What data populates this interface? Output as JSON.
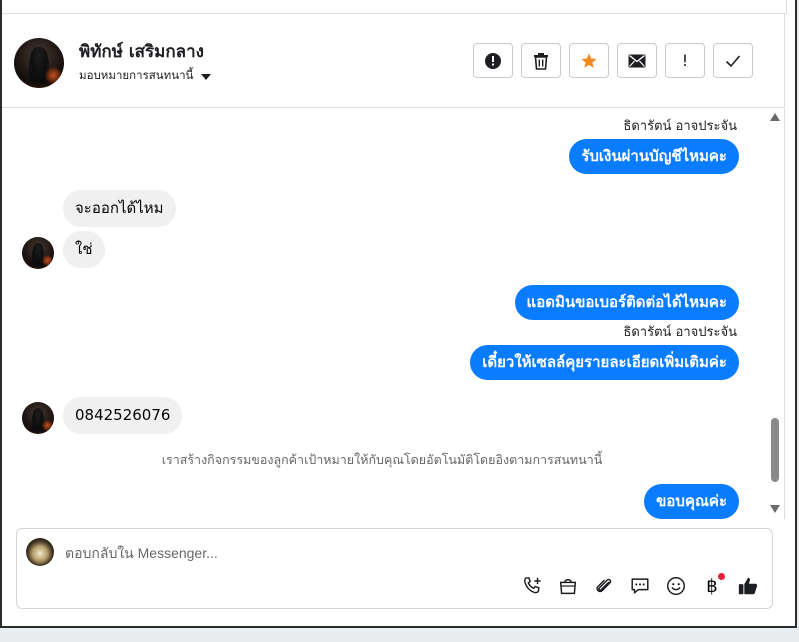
{
  "header": {
    "name": "พิทักษ์ เสริมกลาง",
    "assign_label": "มอบหมายการสนทนานี้"
  },
  "actions": [
    {
      "name": "spam-button",
      "icon": "alert-circle-icon"
    },
    {
      "name": "delete-button",
      "icon": "trash-icon"
    },
    {
      "name": "star-button",
      "icon": "star-icon"
    },
    {
      "name": "mark-unread-button",
      "icon": "envelope-icon"
    },
    {
      "name": "follow-up-button",
      "icon": "exclamation-icon",
      "label": "!"
    },
    {
      "name": "mark-done-button",
      "icon": "check-icon"
    }
  ],
  "thread": {
    "messages": [
      {
        "dir": "label",
        "text": "ธิดารัตน์ อาจประจัน"
      },
      {
        "dir": "out",
        "text": "รับเงินผ่านบัญชีไหมคะ"
      },
      {
        "dir": "in",
        "text": "จะออกได้ไหม"
      },
      {
        "dir": "in",
        "text": "ใช่"
      },
      {
        "dir": "out",
        "text": "แอดมินขอเบอร์ติดต่อได้ไหมคะ"
      },
      {
        "dir": "label",
        "text": "ธิดารัตน์ อาจประจัน"
      },
      {
        "dir": "out",
        "text": "เดี๋ยวให้เซลล์คุยรายละเอียดเพิ่มเติมค่ะ"
      },
      {
        "dir": "in",
        "text": "0842526076"
      },
      {
        "dir": "system",
        "text": "เราสร้างกิจกรรมของลูกค้าเป้าหมายให้กับคุณโดยอัตโนมัติโดยอิงตามการสนทนานี้"
      },
      {
        "dir": "out",
        "text": "ขอบคุณค่ะ"
      }
    ]
  },
  "composer": {
    "placeholder": "ตอบกลับใน Messenger..."
  },
  "tools": [
    {
      "name": "call-add-button",
      "icon": "phone-plus-icon"
    },
    {
      "name": "shop-button",
      "icon": "shopping-bag-icon"
    },
    {
      "name": "attach-button",
      "icon": "paperclip-icon"
    },
    {
      "name": "saved-replies-button",
      "icon": "chat-bubble-icon"
    },
    {
      "name": "emoji-button",
      "icon": "smiley-icon"
    },
    {
      "name": "payment-button",
      "icon": "baht-icon",
      "label": "฿",
      "badge_color": "#e41e3f"
    },
    {
      "name": "like-button",
      "icon": "thumbs-up-icon"
    }
  ],
  "colors": {
    "outgoing_bubble": "#0a7cff",
    "incoming_bubble": "#f0f0f0",
    "star": "#f28a1f"
  }
}
